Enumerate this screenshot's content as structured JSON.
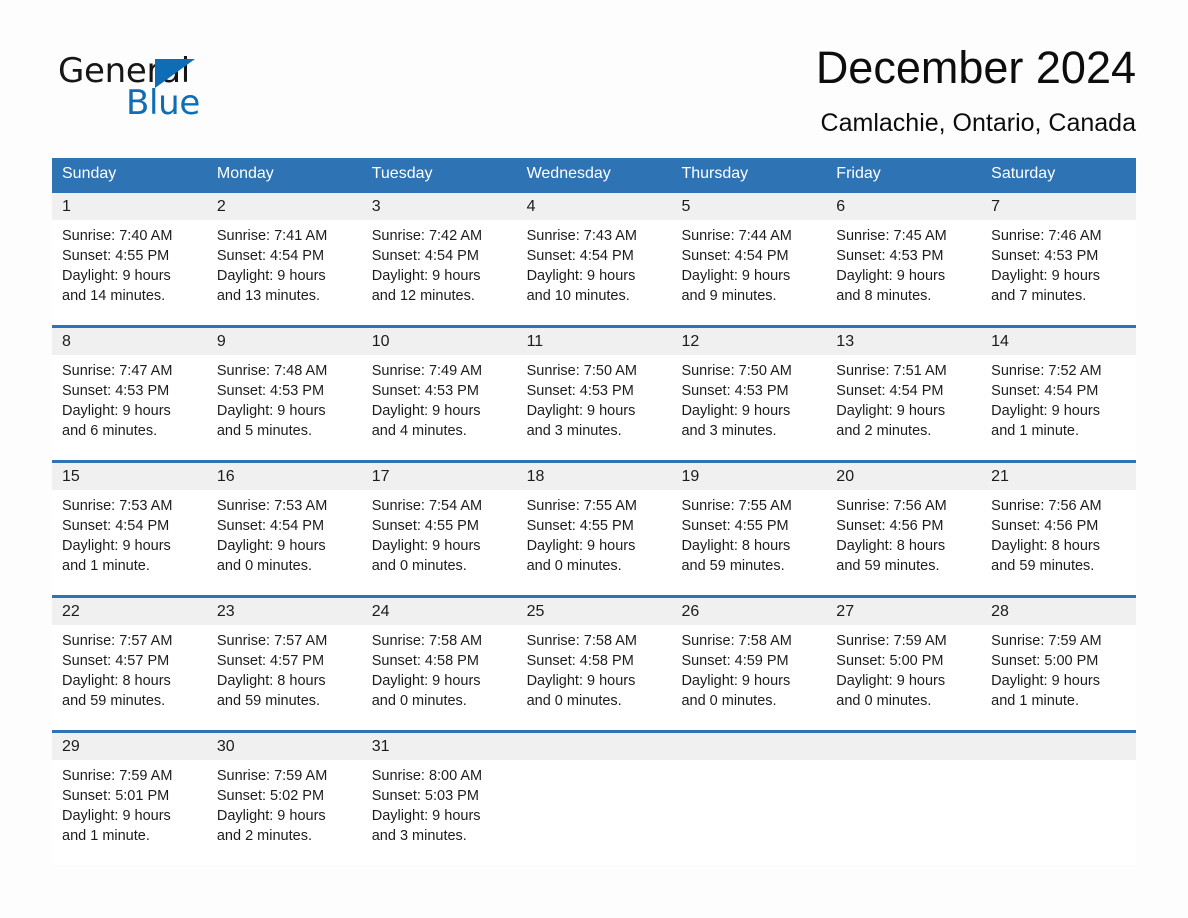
{
  "brand": {
    "name_part1": "General",
    "name_part2": "Blue",
    "accent_color": "#0f6db5",
    "triangle_icon": "right-triangle-logo-mark"
  },
  "header": {
    "title": "December 2024",
    "subtitle": "Camlachie, Ontario, Canada"
  },
  "calendar": {
    "header_bg_color": "#2e73b4",
    "weekdays": [
      "Sunday",
      "Monday",
      "Tuesday",
      "Wednesday",
      "Thursday",
      "Friday",
      "Saturday"
    ],
    "weeks": [
      [
        {
          "day": "1",
          "sunrise": "Sunrise: 7:40 AM",
          "sunset": "Sunset: 4:55 PM",
          "daylight_line1": "Daylight: 9 hours",
          "daylight_line2": "and 14 minutes."
        },
        {
          "day": "2",
          "sunrise": "Sunrise: 7:41 AM",
          "sunset": "Sunset: 4:54 PM",
          "daylight_line1": "Daylight: 9 hours",
          "daylight_line2": "and 13 minutes."
        },
        {
          "day": "3",
          "sunrise": "Sunrise: 7:42 AM",
          "sunset": "Sunset: 4:54 PM",
          "daylight_line1": "Daylight: 9 hours",
          "daylight_line2": "and 12 minutes."
        },
        {
          "day": "4",
          "sunrise": "Sunrise: 7:43 AM",
          "sunset": "Sunset: 4:54 PM",
          "daylight_line1": "Daylight: 9 hours",
          "daylight_line2": "and 10 minutes."
        },
        {
          "day": "5",
          "sunrise": "Sunrise: 7:44 AM",
          "sunset": "Sunset: 4:54 PM",
          "daylight_line1": "Daylight: 9 hours",
          "daylight_line2": "and 9 minutes."
        },
        {
          "day": "6",
          "sunrise": "Sunrise: 7:45 AM",
          "sunset": "Sunset: 4:53 PM",
          "daylight_line1": "Daylight: 9 hours",
          "daylight_line2": "and 8 minutes."
        },
        {
          "day": "7",
          "sunrise": "Sunrise: 7:46 AM",
          "sunset": "Sunset: 4:53 PM",
          "daylight_line1": "Daylight: 9 hours",
          "daylight_line2": "and 7 minutes."
        }
      ],
      [
        {
          "day": "8",
          "sunrise": "Sunrise: 7:47 AM",
          "sunset": "Sunset: 4:53 PM",
          "daylight_line1": "Daylight: 9 hours",
          "daylight_line2": "and 6 minutes."
        },
        {
          "day": "9",
          "sunrise": "Sunrise: 7:48 AM",
          "sunset": "Sunset: 4:53 PM",
          "daylight_line1": "Daylight: 9 hours",
          "daylight_line2": "and 5 minutes."
        },
        {
          "day": "10",
          "sunrise": "Sunrise: 7:49 AM",
          "sunset": "Sunset: 4:53 PM",
          "daylight_line1": "Daylight: 9 hours",
          "daylight_line2": "and 4 minutes."
        },
        {
          "day": "11",
          "sunrise": "Sunrise: 7:50 AM",
          "sunset": "Sunset: 4:53 PM",
          "daylight_line1": "Daylight: 9 hours",
          "daylight_line2": "and 3 minutes."
        },
        {
          "day": "12",
          "sunrise": "Sunrise: 7:50 AM",
          "sunset": "Sunset: 4:53 PM",
          "daylight_line1": "Daylight: 9 hours",
          "daylight_line2": "and 3 minutes."
        },
        {
          "day": "13",
          "sunrise": "Sunrise: 7:51 AM",
          "sunset": "Sunset: 4:54 PM",
          "daylight_line1": "Daylight: 9 hours",
          "daylight_line2": "and 2 minutes."
        },
        {
          "day": "14",
          "sunrise": "Sunrise: 7:52 AM",
          "sunset": "Sunset: 4:54 PM",
          "daylight_line1": "Daylight: 9 hours",
          "daylight_line2": "and 1 minute."
        }
      ],
      [
        {
          "day": "15",
          "sunrise": "Sunrise: 7:53 AM",
          "sunset": "Sunset: 4:54 PM",
          "daylight_line1": "Daylight: 9 hours",
          "daylight_line2": "and 1 minute."
        },
        {
          "day": "16",
          "sunrise": "Sunrise: 7:53 AM",
          "sunset": "Sunset: 4:54 PM",
          "daylight_line1": "Daylight: 9 hours",
          "daylight_line2": "and 0 minutes."
        },
        {
          "day": "17",
          "sunrise": "Sunrise: 7:54 AM",
          "sunset": "Sunset: 4:55 PM",
          "daylight_line1": "Daylight: 9 hours",
          "daylight_line2": "and 0 minutes."
        },
        {
          "day": "18",
          "sunrise": "Sunrise: 7:55 AM",
          "sunset": "Sunset: 4:55 PM",
          "daylight_line1": "Daylight: 9 hours",
          "daylight_line2": "and 0 minutes."
        },
        {
          "day": "19",
          "sunrise": "Sunrise: 7:55 AM",
          "sunset": "Sunset: 4:55 PM",
          "daylight_line1": "Daylight: 8 hours",
          "daylight_line2": "and 59 minutes."
        },
        {
          "day": "20",
          "sunrise": "Sunrise: 7:56 AM",
          "sunset": "Sunset: 4:56 PM",
          "daylight_line1": "Daylight: 8 hours",
          "daylight_line2": "and 59 minutes."
        },
        {
          "day": "21",
          "sunrise": "Sunrise: 7:56 AM",
          "sunset": "Sunset: 4:56 PM",
          "daylight_line1": "Daylight: 8 hours",
          "daylight_line2": "and 59 minutes."
        }
      ],
      [
        {
          "day": "22",
          "sunrise": "Sunrise: 7:57 AM",
          "sunset": "Sunset: 4:57 PM",
          "daylight_line1": "Daylight: 8 hours",
          "daylight_line2": "and 59 minutes."
        },
        {
          "day": "23",
          "sunrise": "Sunrise: 7:57 AM",
          "sunset": "Sunset: 4:57 PM",
          "daylight_line1": "Daylight: 8 hours",
          "daylight_line2": "and 59 minutes."
        },
        {
          "day": "24",
          "sunrise": "Sunrise: 7:58 AM",
          "sunset": "Sunset: 4:58 PM",
          "daylight_line1": "Daylight: 9 hours",
          "daylight_line2": "and 0 minutes."
        },
        {
          "day": "25",
          "sunrise": "Sunrise: 7:58 AM",
          "sunset": "Sunset: 4:58 PM",
          "daylight_line1": "Daylight: 9 hours",
          "daylight_line2": "and 0 minutes."
        },
        {
          "day": "26",
          "sunrise": "Sunrise: 7:58 AM",
          "sunset": "Sunset: 4:59 PM",
          "daylight_line1": "Daylight: 9 hours",
          "daylight_line2": "and 0 minutes."
        },
        {
          "day": "27",
          "sunrise": "Sunrise: 7:59 AM",
          "sunset": "Sunset: 5:00 PM",
          "daylight_line1": "Daylight: 9 hours",
          "daylight_line2": "and 0 minutes."
        },
        {
          "day": "28",
          "sunrise": "Sunrise: 7:59 AM",
          "sunset": "Sunset: 5:00 PM",
          "daylight_line1": "Daylight: 9 hours",
          "daylight_line2": "and 1 minute."
        }
      ],
      [
        {
          "day": "29",
          "sunrise": "Sunrise: 7:59 AM",
          "sunset": "Sunset: 5:01 PM",
          "daylight_line1": "Daylight: 9 hours",
          "daylight_line2": "and 1 minute."
        },
        {
          "day": "30",
          "sunrise": "Sunrise: 7:59 AM",
          "sunset": "Sunset: 5:02 PM",
          "daylight_line1": "Daylight: 9 hours",
          "daylight_line2": "and 2 minutes."
        },
        {
          "day": "31",
          "sunrise": "Sunrise: 8:00 AM",
          "sunset": "Sunset: 5:03 PM",
          "daylight_line1": "Daylight: 9 hours",
          "daylight_line2": "and 3 minutes."
        },
        {
          "day": "",
          "sunrise": "",
          "sunset": "",
          "daylight_line1": "",
          "daylight_line2": ""
        },
        {
          "day": "",
          "sunrise": "",
          "sunset": "",
          "daylight_line1": "",
          "daylight_line2": ""
        },
        {
          "day": "",
          "sunrise": "",
          "sunset": "",
          "daylight_line1": "",
          "daylight_line2": ""
        },
        {
          "day": "",
          "sunrise": "",
          "sunset": "",
          "daylight_line1": "",
          "daylight_line2": ""
        }
      ]
    ]
  }
}
